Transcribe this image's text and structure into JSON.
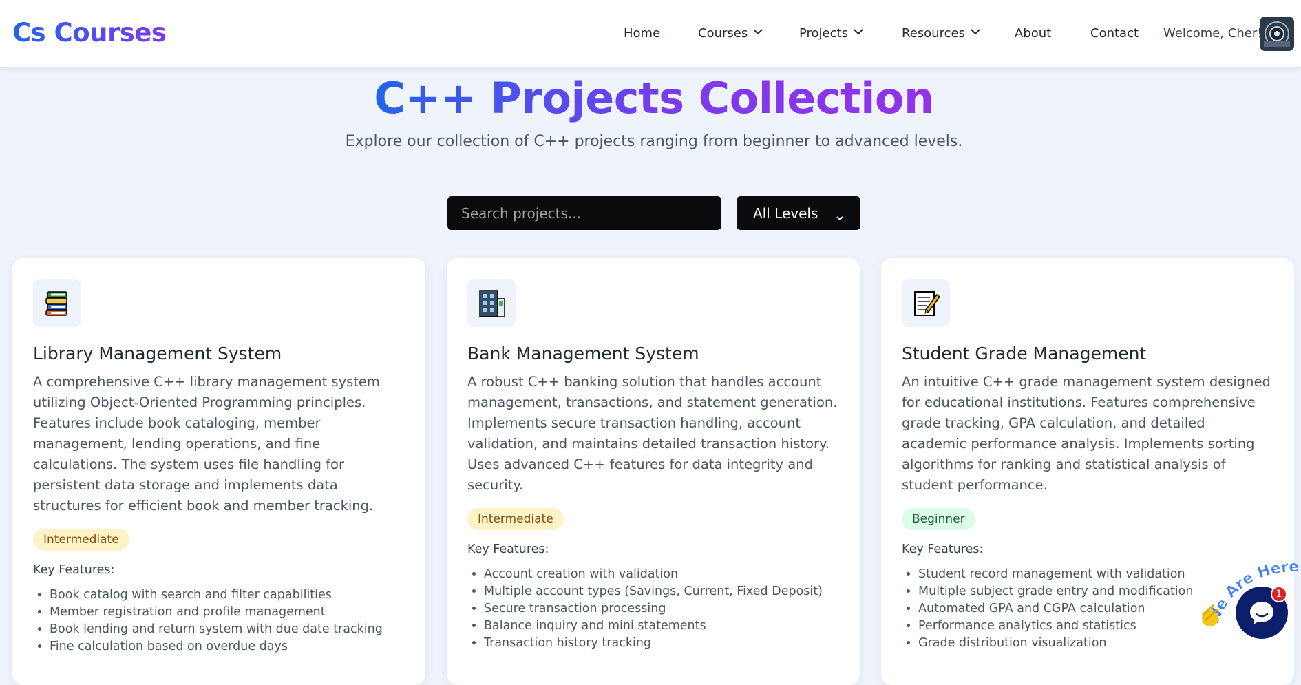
{
  "header": {
    "brand": "Cs Courses",
    "nav": [
      {
        "label": "Home",
        "dropdown": false
      },
      {
        "label": "Courses",
        "dropdown": true
      },
      {
        "label": "Projects",
        "dropdown": true
      },
      {
        "label": "Resources",
        "dropdown": true
      },
      {
        "label": "About",
        "dropdown": false
      },
      {
        "label": "Contact",
        "dropdown": false
      }
    ],
    "welcome": "Welcome, Cher!"
  },
  "hero": {
    "title": "C++ Projects Collection",
    "subtitle": "Explore our collection of C++ projects ranging from beginner to advanced levels."
  },
  "filters": {
    "search_placeholder": "Search projects...",
    "level_selected": "All Levels"
  },
  "cards": [
    {
      "icon": "books-icon",
      "title": "Library Management System",
      "description": "A comprehensive C++ library management system utilizing Object-Oriented Programming principles. Features include book cataloging, member management, lending operations, and fine calculations. The system uses file handling for persistent data storage and implements data structures for efficient book and member tracking.",
      "level": "Intermediate",
      "features_label": "Key Features:",
      "features": [
        "Book catalog with search and filter capabilities",
        "Member registration and profile management",
        "Book lending and return system with due date tracking",
        "Fine calculation based on overdue days"
      ]
    },
    {
      "icon": "bank-building-icon",
      "title": "Bank Management System",
      "description": "A robust C++ banking solution that handles account management, transactions, and statement generation. Implements secure transaction handling, account validation, and maintains detailed transaction history. Uses advanced C++ features for data integrity and security.",
      "level": "Intermediate",
      "features_label": "Key Features:",
      "features": [
        "Account creation with validation",
        "Multiple account types (Savings, Current, Fixed Deposit)",
        "Secure transaction processing",
        "Balance inquiry and mini statements",
        "Transaction history tracking"
      ]
    },
    {
      "icon": "memo-pencil-icon",
      "title": "Student Grade Management",
      "description": "An intuitive C++ grade management system designed for educational institutions. Features comprehensive grade tracking, GPA calculation, and detailed academic performance analysis. Implements sorting algorithms for ranking and statistical analysis of student performance.",
      "level": "Beginner",
      "features_label": "Key Features:",
      "features": [
        "Student record management with validation",
        "Multiple subject grade entry and modification",
        "Automated GPA and CGPA calculation",
        "Performance analytics and statistics",
        "Grade distribution visualization"
      ]
    }
  ],
  "chat": {
    "tagline": "We Are Here!",
    "unread": "1"
  }
}
